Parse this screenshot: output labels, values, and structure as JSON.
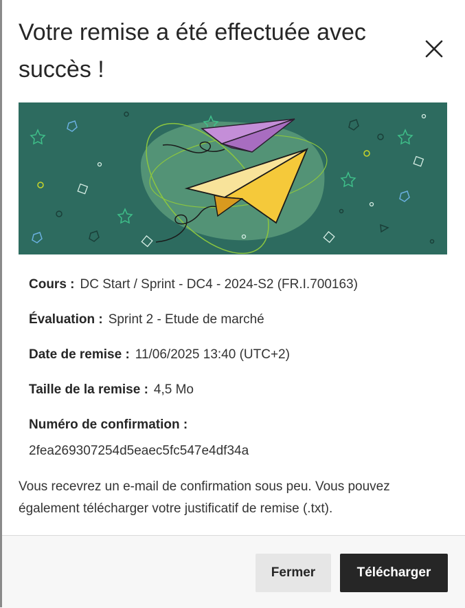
{
  "dialog": {
    "title": "Votre remise a été effectuée avec succès !",
    "close_label": "Fermer la boîte de dialogue"
  },
  "details": {
    "course_label": "Cours :",
    "course_value": "DC Start / Sprint - DC4 - 2024-S2 (FR.I.700163)",
    "assessment_label": "Évaluation :",
    "assessment_value": "Sprint 2 - Etude de marché",
    "date_label": "Date de remise :",
    "date_value": "11/06/2025 13:40 (UTC+2)",
    "size_label": "Taille de la remise :",
    "size_value": "4,5 Mo",
    "confirmation_label": "Numéro de confirmation :",
    "confirmation_value": "2fea269307254d5eaec5fc547e4df34a"
  },
  "note": "Vous recevrez un e-mail de confirmation sous peu. Vous pouvez également télécharger votre justificatif de remise (.txt).",
  "footer": {
    "close_button": "Fermer",
    "download_button": "Télécharger"
  },
  "colors": {
    "banner_bg": "#2d6b5f",
    "primary_button": "#262626",
    "secondary_button": "#e6e6e6",
    "plane_yellow": "#f5c93a",
    "plane_purple": "#c48ed8"
  },
  "icons": {
    "close": "close-icon",
    "illustration": "paper-planes-illustration"
  }
}
